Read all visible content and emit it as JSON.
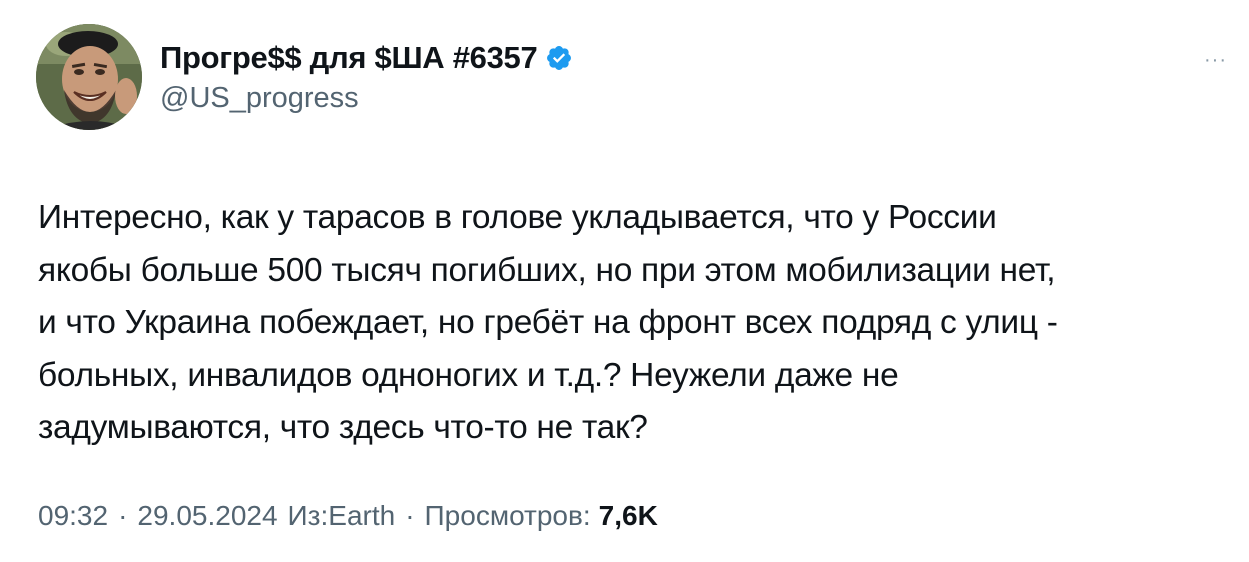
{
  "author": {
    "display_name": "Прогре$$ для $ША #6357",
    "handle": "@US_progress",
    "verified": true,
    "verified_color": "#1d9bf0"
  },
  "menu": {
    "more_label": "···"
  },
  "tweet": {
    "text": "Интересно, как у тарасов в голове укладывается, что у России\nякобы больше 500 тысяч погибших, но при этом мобилизации нет,\nи что Украина побеждает, но гребёт на фронт всех подряд с улиц -\nбольных, инвалидов одноногих и т.д.? Неужели даже не\nзадумываются, что здесь что-то не так?"
  },
  "meta": {
    "time": "09:32",
    "separator": "·",
    "date": "29.05.2024",
    "source": "Из:Earth",
    "views_label": "Просмотров:",
    "views_count": "7,6K"
  }
}
